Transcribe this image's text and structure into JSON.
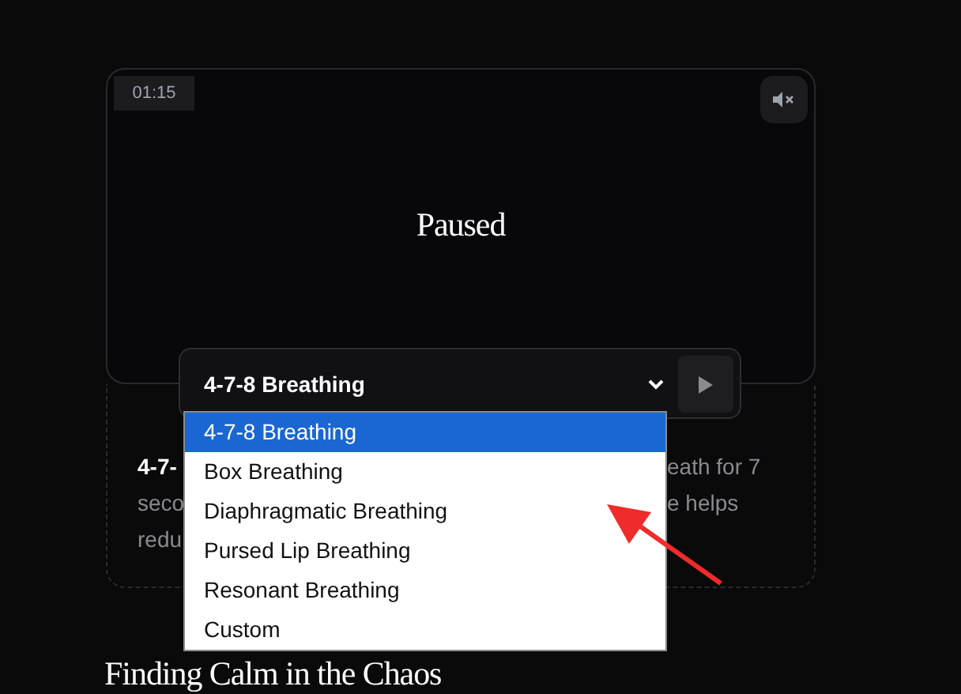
{
  "player": {
    "timer": "01:15",
    "status": "Paused",
    "muted": true
  },
  "technique_select": {
    "value": "4-7-8 Breathing",
    "expanded": true,
    "options": [
      {
        "label": "4-7-8 Breathing",
        "selected": true
      },
      {
        "label": "Box Breathing",
        "selected": false
      },
      {
        "label": "Diaphragmatic Breathing",
        "selected": false
      },
      {
        "label": "Pursed Lip Breathing",
        "selected": false
      },
      {
        "label": "Resonant Breathing",
        "selected": false
      },
      {
        "label": "Custom",
        "selected": false
      }
    ]
  },
  "description": {
    "lines": [
      {
        "left": {
          "text": "4-7-",
          "bold": true
        },
        "right": {
          "text": "eath for 7",
          "bold": false
        }
      },
      {
        "left": {
          "text": "seco",
          "bold": false
        },
        "right": {
          "text": "e helps",
          "bold": false
        }
      },
      {
        "left": {
          "text": "redu",
          "bold": false
        }
      }
    ]
  },
  "heading": "Finding Calm in the Chaos"
}
